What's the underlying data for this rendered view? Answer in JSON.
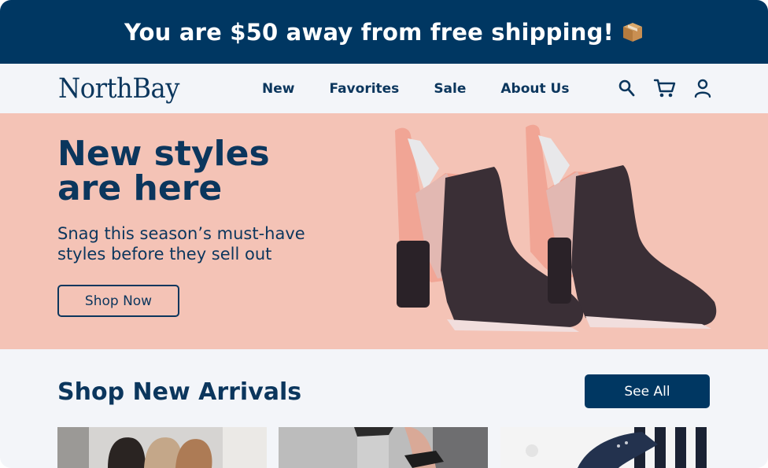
{
  "promo": {
    "text": "You are $50 away from free shipping!",
    "icon": "package-box-icon"
  },
  "nav": {
    "logo": "NorthBay",
    "links": [
      "New",
      "Favorites",
      "Sale",
      "About Us"
    ],
    "icons": [
      "search-icon",
      "cart-icon",
      "user-account-icon"
    ]
  },
  "hero": {
    "title_line1": "New styles",
    "title_line2": "are here",
    "subtitle": "Snag this season’s must-have styles before they sell out",
    "cta_label": "Shop Now"
  },
  "arrivals": {
    "title": "Shop New Arrivals",
    "see_all_label": "See All",
    "products": [
      {
        "image": "flat-shoes-photo"
      },
      {
        "image": "sandals-on-feet-photo"
      },
      {
        "image": "striped-sneakers-photo"
      }
    ]
  },
  "colors": {
    "primary": "#003762",
    "text": "#0b365d",
    "hero_bg": "#f4c3b6",
    "page_bg": "#f3f5f9"
  }
}
